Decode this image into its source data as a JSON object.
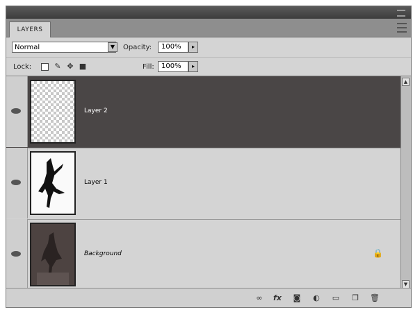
{
  "panel": {
    "tab_label": "LAYERS"
  },
  "options": {
    "blend_mode": "Normal",
    "opacity_label": "Opacity:",
    "opacity_value": "100%",
    "lock_label": "Lock:",
    "fill_label": "Fill:",
    "fill_value": "100%"
  },
  "layers": [
    {
      "name": "Layer 2",
      "selected": true,
      "thumbnail": "transparent"
    },
    {
      "name": "Layer 1",
      "selected": false,
      "thumbnail": "dancer-silhouette"
    },
    {
      "name": "Background",
      "selected": false,
      "thumbnail": "dancer-photo",
      "locked": true
    }
  ],
  "bottom_icons": [
    "link-layers-icon",
    "layer-style-fx-icon",
    "layer-mask-icon",
    "adjustment-layer-icon",
    "new-group-icon",
    "new-layer-icon",
    "delete-layer-icon"
  ],
  "bottom_labels": {
    "fx": "fx"
  },
  "colors": {
    "selected_row": "#4a4646",
    "panel_bg": "#d4d4d4",
    "title_bar": "#3d3d3d"
  }
}
